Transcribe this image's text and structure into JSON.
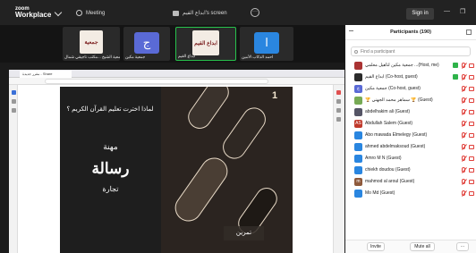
{
  "app": {
    "brand_top": "zoom",
    "brand_bottom": "Workplace"
  },
  "toolbar": {
    "meeting_label": "Meeting",
    "screen_share_title": "ابداع القيم's screen",
    "sign_in": "Sign in",
    "minimize": "—",
    "restore": "❐"
  },
  "strip": {
    "tiles": [
      {
        "name": "جمعية الشيخ ...مكتب ناجيقي شمال",
        "kind": "image",
        "img_text": "جمعية"
      },
      {
        "name": "جمعية مكين",
        "kind": "letter",
        "letter": "ج",
        "color": "#5a6ad6"
      },
      {
        "name": "ابداع القيم",
        "kind": "image",
        "img_text": "ابداع القيم",
        "active": true
      },
      {
        "name": "أحمد الذكاب الأمين",
        "kind": "letter",
        "letter": "ا",
        "color": "#2a86e0"
      }
    ]
  },
  "browser": {
    "tab_title": "مقرر جدیدة - Share"
  },
  "slide": {
    "question": "لماذا اخترت تعليم القرآن الكريم ؟",
    "word1": "مهنة",
    "word2": "رسالة",
    "word3": "تجارة",
    "page_number": "1",
    "tag": "تمرين"
  },
  "participants": {
    "title": "Participants (190)",
    "search_placeholder": "Find a participant",
    "list": [
      {
        "name": "جمعية مكين لتأهيل معلمي ...(Host, me)",
        "avatar": "",
        "color": "#a33",
        "green": true
      },
      {
        "name": "ابداع القيم (Co-host, guest)",
        "avatar": "",
        "color": "#2c2c2c",
        "green": true
      },
      {
        "name": "جمعية مكين (Co-host, guest)",
        "avatar": "ج",
        "color": "#5a6ad6",
        "green": false
      },
      {
        "name": "🏆 سماهر محمد الجهني 🏆 (Guest)",
        "avatar": "",
        "color": "#7a5",
        "green": false
      },
      {
        "name": "abdelhakim ali (Guest)",
        "avatar": "",
        "color": "#556",
        "green": false
      },
      {
        "name": "Abdullah Salem (Guest)",
        "avatar": "AS",
        "color": "#c0392b",
        "green": false
      },
      {
        "name": "Abo mawada Elmelegy (Guest)",
        "avatar": "",
        "color": "#2a86e0",
        "green": false
      },
      {
        "name": "ahmed abdelmaksoud (Guest)",
        "avatar": "",
        "color": "#2a86e0",
        "green": false
      },
      {
        "name": "Amro M N (Guest)",
        "avatar": "",
        "color": "#2a86e0",
        "green": false
      },
      {
        "name": "chiekh doudou (Guest)",
        "avatar": "",
        "color": "#2a86e0",
        "green": false
      },
      {
        "name": "mahmod al aroul (Guest)",
        "avatar": "m",
        "color": "#8e5a3c",
        "green": false
      },
      {
        "name": "Mo Md (Guest)",
        "avatar": "",
        "color": "#2a86e0",
        "green": false
      }
    ],
    "invite": "Invite",
    "mute_all": "Mute all",
    "more": "···"
  }
}
